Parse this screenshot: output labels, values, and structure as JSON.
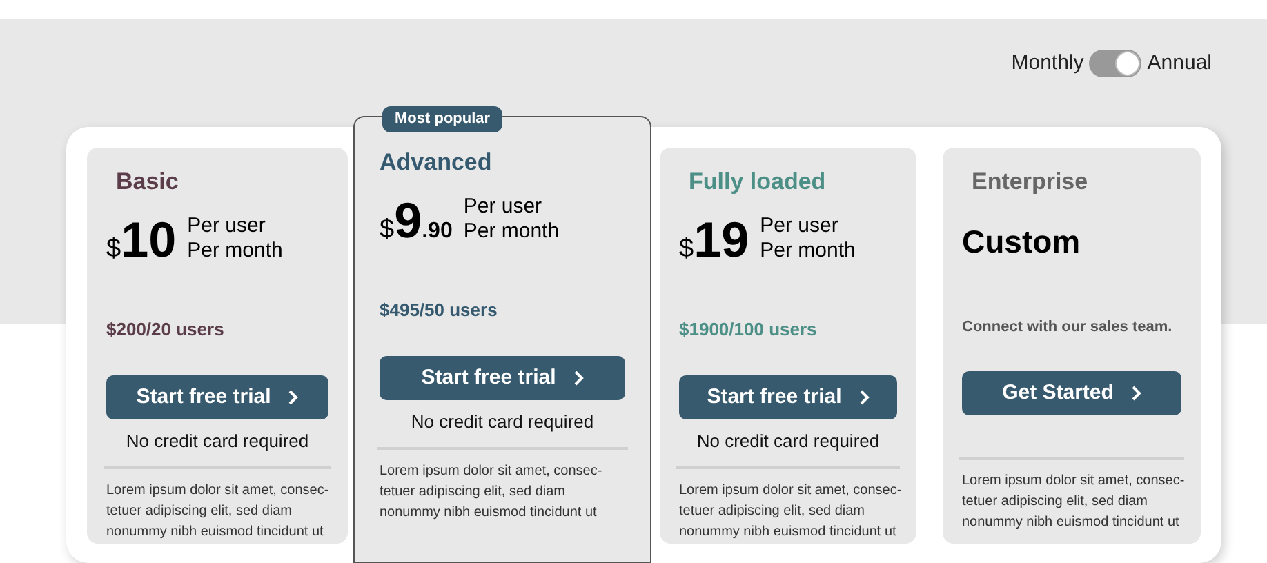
{
  "billing_toggle": {
    "left_label": "Monthly",
    "right_label": "Annual",
    "on": true
  },
  "plans": [
    {
      "name": "Basic",
      "color": "#5b3d4a",
      "featured": false,
      "price": {
        "kind": "amount",
        "currency": "$",
        "amount": "10",
        "unit_lines": [
          "Per user",
          "Per month"
        ]
      },
      "total": "$200/20 users",
      "button": "Start free trial",
      "note": "No credit card required",
      "description_lines": [
        "Lorem ipsum dolor sit amet, consec-",
        "tetuer adipiscing elit, sed diam",
        "nonummy nibh euismod tincidunt ut"
      ]
    },
    {
      "name": "Advanced",
      "color": "#355a70",
      "featured": true,
      "badge": "Most popular",
      "price": {
        "kind": "amount",
        "currency": "$",
        "amount": "9",
        "cents": ".90",
        "unit_lines": [
          "Per user",
          "Per month"
        ]
      },
      "total": "$495/50 users",
      "button": "Start free trial",
      "note": "No credit card required",
      "description_lines": [
        "Lorem ipsum dolor sit amet, consec-",
        "tetuer adipiscing elit, sed diam",
        "nonummy nibh euismod tincidunt ut"
      ]
    },
    {
      "name": "Fully loaded",
      "color": "#4c8f86",
      "featured": false,
      "price": {
        "kind": "amount",
        "currency": "$",
        "amount": "19",
        "unit_lines": [
          "Per user",
          "Per month"
        ]
      },
      "total": "$1900/100 users",
      "button": "Start free trial",
      "note": "No credit card required",
      "description_lines": [
        "Lorem ipsum dolor sit amet, consec-",
        "tetuer adipiscing elit, sed diam",
        "nonummy nibh euismod tincidunt ut"
      ]
    },
    {
      "name": "Enterprise",
      "color": "#666666",
      "featured": false,
      "price": {
        "kind": "custom",
        "text": "Custom"
      },
      "total": "Connect with our sales team.",
      "button": "Get Started",
      "description_lines": [
        "Lorem ipsum dolor sit amet, consec-",
        "tetuer adipiscing elit, sed diam",
        "nonummy nibh euismod tincidunt ut"
      ]
    }
  ]
}
